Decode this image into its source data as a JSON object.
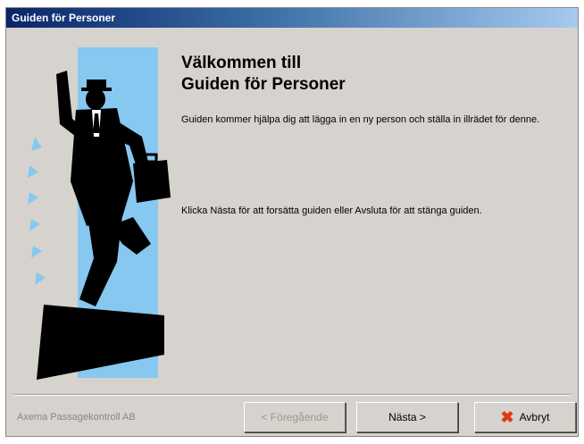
{
  "window": {
    "title": "Guiden för Personer"
  },
  "content": {
    "heading_line1": "Välkommen till",
    "heading_line2": "Guiden för Personer",
    "paragraph1": "Guiden kommer hjälpa dig att lägga in en ny person och ställa in illrädet för denne.",
    "paragraph2": "Klicka Nästa för att forsätta guiden eller Avsluta för att stänga guiden."
  },
  "footer": {
    "company": "Axema Passagekontroll AB",
    "prev_label": "< Föregående",
    "next_label": "Nästa >",
    "cancel_label": "Avbryt",
    "cancel_icon": "close-x-icon"
  },
  "colors": {
    "accent_blue": "#86c8f0",
    "cancel_x": "#e03a10"
  }
}
